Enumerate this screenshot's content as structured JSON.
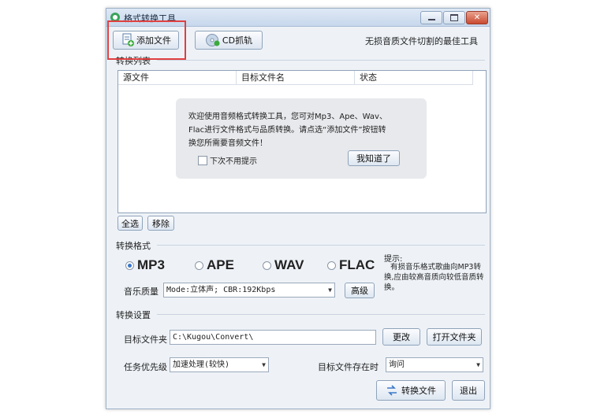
{
  "window": {
    "title": "格式转换工具"
  },
  "toolbar": {
    "add_file": "添加文件",
    "cd_rip": "CD抓轨",
    "slogan": "无损音质文件切割的最佳工具"
  },
  "convert_list": {
    "label": "转换列表",
    "columns": [
      "源文件",
      "目标文件名",
      "状态"
    ],
    "select_all": "全选",
    "remove": "移除"
  },
  "welcome": {
    "line1": "欢迎使用音频格式转换工具，您可对Mp3、Ape、Wav、",
    "line2": "Flac进行文件格式与品质转换。请点选“添加文件”按钮转",
    "line3": "换您所需要音频文件！",
    "dont_show": "下次不用提示",
    "got_it": "我知道了"
  },
  "format": {
    "label": "转换格式",
    "options": [
      "MP3",
      "APE",
      "WAV",
      "FLAC"
    ],
    "selected": "MP3",
    "quality_label": "音乐质量",
    "quality_value": "Mode:立体声; CBR:192Kbps",
    "advanced": "高级",
    "tip_title": "提示:",
    "tip_body": "有损音乐格式歌曲向MP3转换,应由较高音质向较低音质转换。"
  },
  "settings": {
    "label": "转换设置",
    "target_folder_label": "目标文件夹",
    "target_folder_value": "C:\\Kugou\\Convert\\",
    "change": "更改",
    "open_folder": "打开文件夹",
    "priority_label": "任务优先级",
    "priority_value": "加速处理(较快)",
    "exists_label": "目标文件存在时",
    "exists_value": "询问"
  },
  "footer": {
    "convert": "转换文件",
    "exit": "退出"
  },
  "colors": {
    "accent": "#3a78c8",
    "highlight": "#e04040",
    "window_bg": "#eef2f7"
  }
}
